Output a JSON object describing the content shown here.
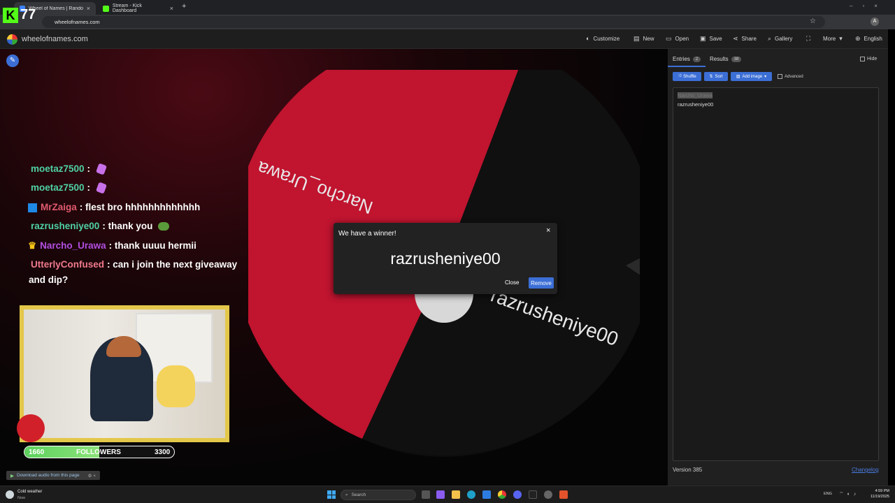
{
  "browser": {
    "tabs": [
      {
        "title": "Wheel of Names | Random nam",
        "active": true
      },
      {
        "title": "Stream - Kick Dashboard",
        "active": false
      }
    ],
    "url": "wheelofnames.com"
  },
  "stream_overlay": {
    "kick_badge": "77"
  },
  "app": {
    "site_name": "wheelofnames.com",
    "menu": {
      "customize": "Customize",
      "new": "New",
      "open": "Open",
      "save": "Save",
      "share": "Share",
      "gallery": "Gallery",
      "more": "More",
      "language": "English"
    }
  },
  "wheel": {
    "slices": [
      {
        "label": "Narcho_Urawa",
        "color": "#c0142f"
      },
      {
        "label": "razrusheniye00",
        "color": "#101010"
      }
    ]
  },
  "panel": {
    "tab_entries": "Entries",
    "entries_count": "2",
    "tab_results": "Results",
    "results_count": "38",
    "hide": "Hide",
    "shuffle": "Shuffle",
    "sort": "Sort",
    "add_image": "Add image",
    "advanced": "Advanced",
    "entries": [
      "Narcho_Urawa",
      "razrusheniye00"
    ],
    "version": "Version 385",
    "changelog": "Changelog"
  },
  "modal": {
    "title": "We have a winner!",
    "winner": "razrusheniye00",
    "close_label": "Close",
    "remove_label": "Remove"
  },
  "chat": [
    {
      "user": "moetaz7500",
      "sep": ":",
      "text": "",
      "color": "#4fd1a5"
    },
    {
      "user": "moetaz7500",
      "sep": ":",
      "text": "",
      "color": "#4fd1a5"
    },
    {
      "user": "MrZaiga",
      "sep": ":",
      "text": "flest bro hhhhhhhhhhhhh",
      "color": "#e05a6e"
    },
    {
      "user": "razrusheniye00",
      "sep": ":",
      "text": "thank you",
      "color": "#4fd1a5"
    },
    {
      "user": "Narcho_Urawa",
      "sep": ":",
      "text": "thank uuuu hermii",
      "color": "#b24ee0"
    },
    {
      "user": "UtterlyConfused",
      "sep": ":",
      "text": "can i join the next giveaway",
      "color": "#f07a8c"
    }
  ],
  "chat_continuation": "and dip?",
  "followers": {
    "current": "1660",
    "label": "FOLLOWERS",
    "goal": "3300",
    "progress": 0.5
  },
  "download_bar": "Download audio from this page",
  "taskbar": {
    "weather_title": "Cold weather",
    "weather_sub": "Now",
    "search_placeholder": "Search",
    "lang": "ENG",
    "time": "4:59 PM",
    "date": "11/19/2025"
  }
}
